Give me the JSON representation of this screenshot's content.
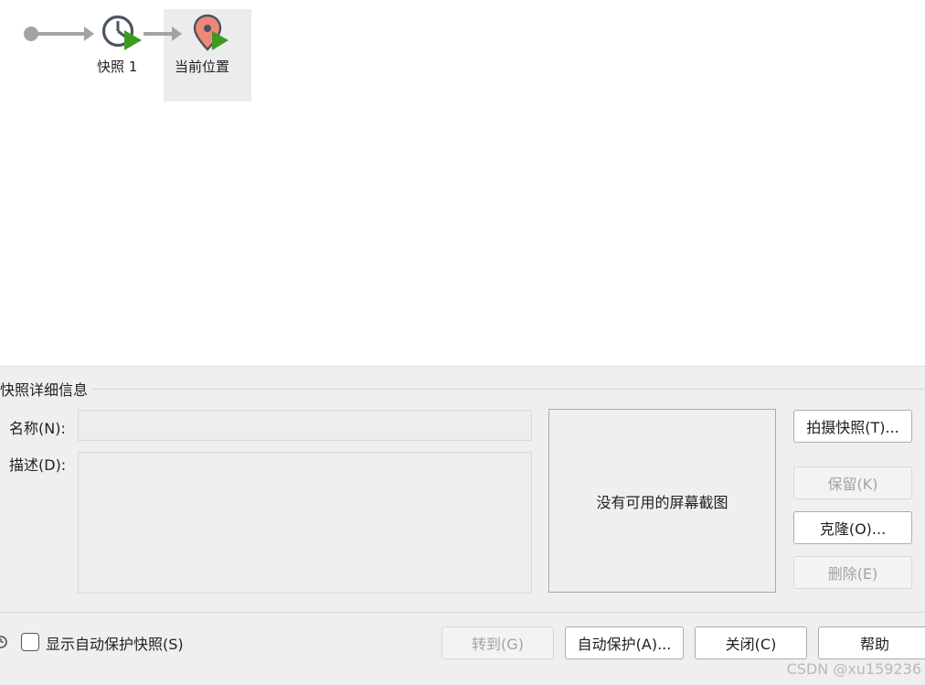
{
  "tree": {
    "nodes": [
      {
        "label": "快照 1",
        "icon": "clock-play-icon"
      },
      {
        "label": "当前位置",
        "icon": "location-pin-play-icon",
        "selected": true
      }
    ],
    "colors": {
      "connector": "#a0a4a8",
      "clock": "#4a5560",
      "play": "#3c9b1f",
      "pin": "#f08878"
    }
  },
  "details": {
    "title": "快照详细信息",
    "name_label": "名称(N):",
    "name_value": "",
    "desc_label": "描述(D):",
    "desc_value": "",
    "screenshot_text": "没有可用的屏幕截图"
  },
  "side_buttons": {
    "take_snapshot": "拍摄快照(T)...",
    "keep": "保留(K)",
    "clone": "克隆(O)...",
    "delete": "删除(E)"
  },
  "footer": {
    "show_autoprotect": "显示自动保护快照(S)",
    "goto": "转到(G)",
    "autoprotect": "自动保护(A)...",
    "close": "关闭(C)",
    "help": "帮助"
  },
  "watermark": "CSDN @xu159236"
}
